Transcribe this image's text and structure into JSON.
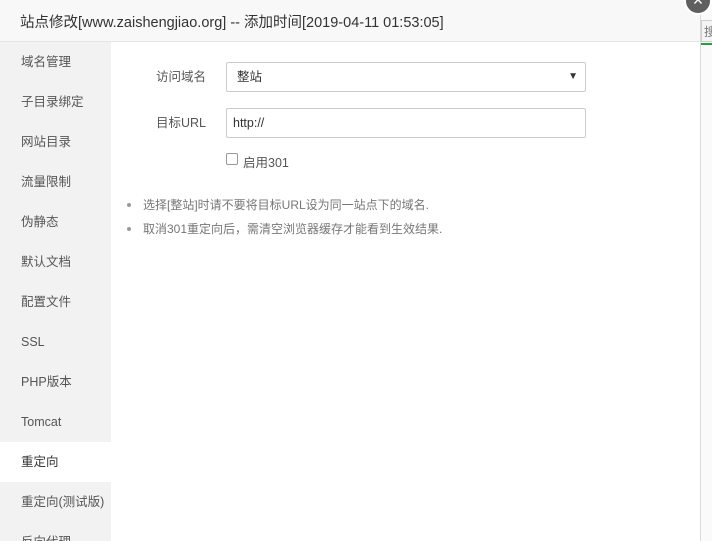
{
  "background": {
    "button_fragment": "搜"
  },
  "dialog": {
    "title": "站点修改[www.zaishengjiao.org] -- 添加时间[2019-04-11 01:53:05]",
    "close_symbol": "×"
  },
  "sidebar": {
    "items": [
      {
        "label": "域名管理"
      },
      {
        "label": "子目录绑定"
      },
      {
        "label": "网站目录"
      },
      {
        "label": "流量限制"
      },
      {
        "label": "伪静态"
      },
      {
        "label": "默认文档"
      },
      {
        "label": "配置文件"
      },
      {
        "label": "SSL"
      },
      {
        "label": "PHP版本"
      },
      {
        "label": "Tomcat"
      },
      {
        "label": "重定向"
      },
      {
        "label": "重定向(测试版)"
      },
      {
        "label": "反向代理"
      }
    ],
    "active_index": 10
  },
  "form": {
    "domain_label": "访问域名",
    "domain_value": "整站",
    "url_label": "目标URL",
    "url_value": "http://",
    "enable_label": "启用301",
    "enable_checked": false
  },
  "tips": [
    "选择[整站]时请不要将目标URL设为同一站点下的域名.",
    "取消301重定向后，需清空浏览器缓存才能看到生效结果."
  ]
}
